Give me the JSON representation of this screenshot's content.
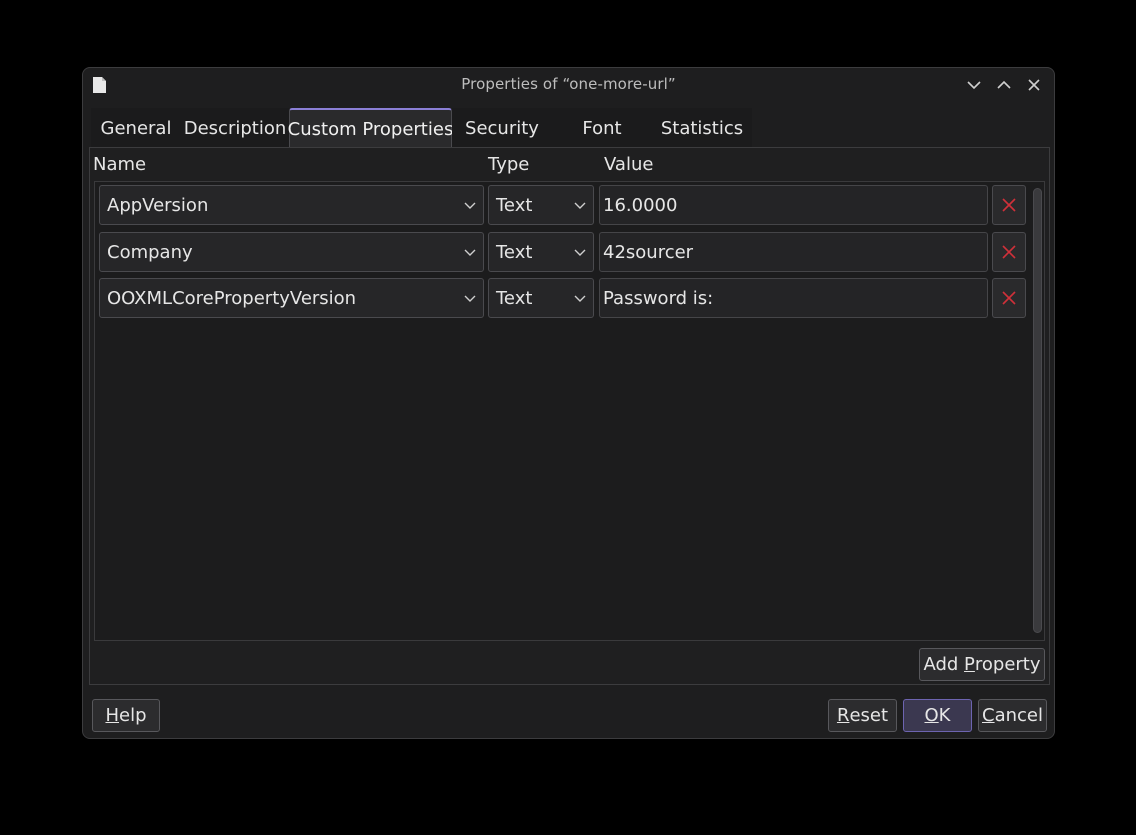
{
  "window": {
    "title": "Properties of “one-more-url”"
  },
  "tabs": [
    {
      "label": "General"
    },
    {
      "label": "Description"
    },
    {
      "label": "Custom Properties"
    },
    {
      "label": "Security"
    },
    {
      "label": "Font"
    },
    {
      "label": "Statistics"
    }
  ],
  "active_tab": "Custom Properties",
  "columns": {
    "name": "Name",
    "type": "Type",
    "value": "Value"
  },
  "properties": [
    {
      "name": "AppVersion",
      "type": "Text",
      "value": "16.0000"
    },
    {
      "name": "Company",
      "type": "Text",
      "value": "42sourcer"
    },
    {
      "name": "OOXMLCorePropertyVersion",
      "type": "Text",
      "value": "Password is:"
    }
  ],
  "buttons": {
    "add_property": {
      "pre": "Add ",
      "mnemonic": "P",
      "post": "roperty"
    },
    "help": {
      "pre": "",
      "mnemonic": "H",
      "post": "elp"
    },
    "reset": {
      "pre": "",
      "mnemonic": "R",
      "post": "eset"
    },
    "ok": {
      "pre": "",
      "mnemonic": "O",
      "post": "K"
    },
    "cancel": {
      "pre": "",
      "mnemonic": "C",
      "post": "ancel"
    }
  },
  "colors": {
    "accent": "#8b7fd6",
    "delete_icon": "#d0303a",
    "background": "#1e1e1f"
  },
  "icons": {
    "document": "document-icon",
    "minimize": "chevron-down-icon",
    "maximize": "chevron-up-icon",
    "close": "close-icon",
    "delete": "delete-x-icon",
    "dropdown": "chevron-down-icon"
  }
}
